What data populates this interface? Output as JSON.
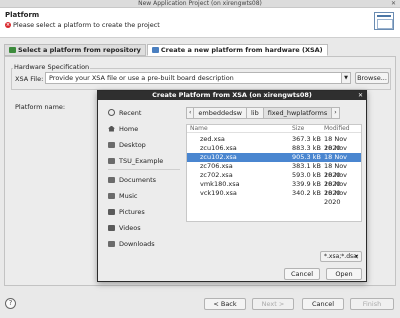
{
  "window": {
    "title": "New Application Project  (on xirengwts08)",
    "close": "✕"
  },
  "header": {
    "title": "Platform",
    "message": "Please select a platform to create the project"
  },
  "tabs": [
    {
      "label": "Select a platform from repository"
    },
    {
      "label": "Create a new platform from hardware (XSA)"
    }
  ],
  "hw_spec": {
    "group_title": "Hardware Specification",
    "xsa_label": "XSA File:",
    "xsa_value": "Provide your XSA file or use a pre-built board description",
    "browse_label": "Browse..."
  },
  "platform_name_label": "Platform name:",
  "footer": {
    "help": "?",
    "back": "< Back",
    "next": "Next >",
    "cancel": "Cancel",
    "finish": "Finish"
  },
  "dialog": {
    "title": "Create Platform from XSA (on xirengwts08)",
    "close": "✕",
    "places": [
      {
        "label": "Recent",
        "icon": "clock-icon"
      },
      {
        "label": "Home",
        "icon": "home-icon"
      },
      {
        "label": "Desktop",
        "icon": "folder-icon"
      },
      {
        "label": "TSU_Example",
        "icon": "folder-icon"
      },
      {
        "label": "Documents",
        "icon": "folder-icon"
      },
      {
        "label": "Music",
        "icon": "music-icon"
      },
      {
        "label": "Pictures",
        "icon": "pictures-icon"
      },
      {
        "label": "Videos",
        "icon": "videos-icon"
      },
      {
        "label": "Downloads",
        "icon": "downloads-icon"
      }
    ],
    "breadcrumb": {
      "back": "‹",
      "items": [
        "embeddedsw",
        "lib",
        "fixed_hwplatforms"
      ],
      "forward": "›"
    },
    "columns": {
      "name": "Name",
      "size": "Size",
      "modified": "Modified"
    },
    "files": [
      {
        "name": "zed.xsa",
        "size": "367.3 kB",
        "modified": "18 Nov 2020"
      },
      {
        "name": "zcu106.xsa",
        "size": "883.3 kB",
        "modified": "18 Nov 2020"
      },
      {
        "name": "zcu102.xsa",
        "size": "905.3 kB",
        "modified": "18 Nov 2020"
      },
      {
        "name": "zc706.xsa",
        "size": "383.1 kB",
        "modified": "18 Nov 2020"
      },
      {
        "name": "zc702.xsa",
        "size": "593.0 kB",
        "modified": "18 Nov 2020"
      },
      {
        "name": "vmk180.xsa",
        "size": "339.9 kB",
        "modified": "18 Nov 2020"
      },
      {
        "name": "vck190.xsa",
        "size": "340.2 kB",
        "modified": "18 Nov 2020"
      }
    ],
    "selected_file": "zcu102.xsa",
    "filter": "*.xsa;*.dsa;",
    "filter_arrow": "▾",
    "cancel": "Cancel",
    "open": "Open"
  }
}
